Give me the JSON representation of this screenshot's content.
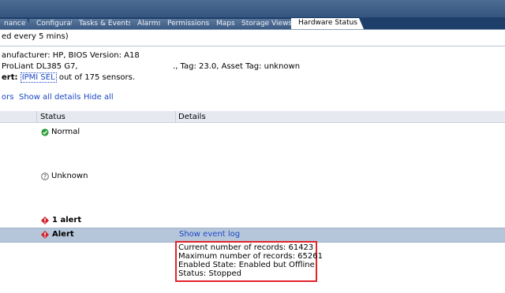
{
  "tabs": [
    "nance",
    "Configuration",
    "Tasks & Events",
    "Alarms",
    "Permissions",
    "Maps",
    "Storage Views",
    "Hardware Status"
  ],
  "refresh_note": "ed every 5 mins)",
  "info": {
    "line1": "anufacturer: HP, BIOS Version: A18",
    "line2_left": "ProLiant DL385 G7,",
    "line2_right": "., Tag: 23.0,  Asset Tag: unknown",
    "alert_label": "ert:",
    "alert_link": "IPMI SEL",
    "alert_rest": " out of 175 sensors."
  },
  "actions": {
    "sensors_partial": "ors",
    "show_all_details": "Show all details",
    "hide_all": "Hide all"
  },
  "table": {
    "col_status": "Status",
    "col_details": "Details",
    "status_normal": "Normal",
    "status_unknown": "Unknown",
    "status_alert_count": "1 alert",
    "selected_status": "Alert",
    "selected_details_link": "Show event log"
  },
  "event_details": [
    "Current number of records: 61423",
    "Maximum number of records: 65261",
    "Enabled State: Enabled but Offline",
    "Status: Stopped"
  ],
  "colors": {
    "alert_red": "#d0202a",
    "ok_green": "#2e9e3a",
    "link_blue": "#1a47c4",
    "highlight_box": "#e2232a"
  }
}
